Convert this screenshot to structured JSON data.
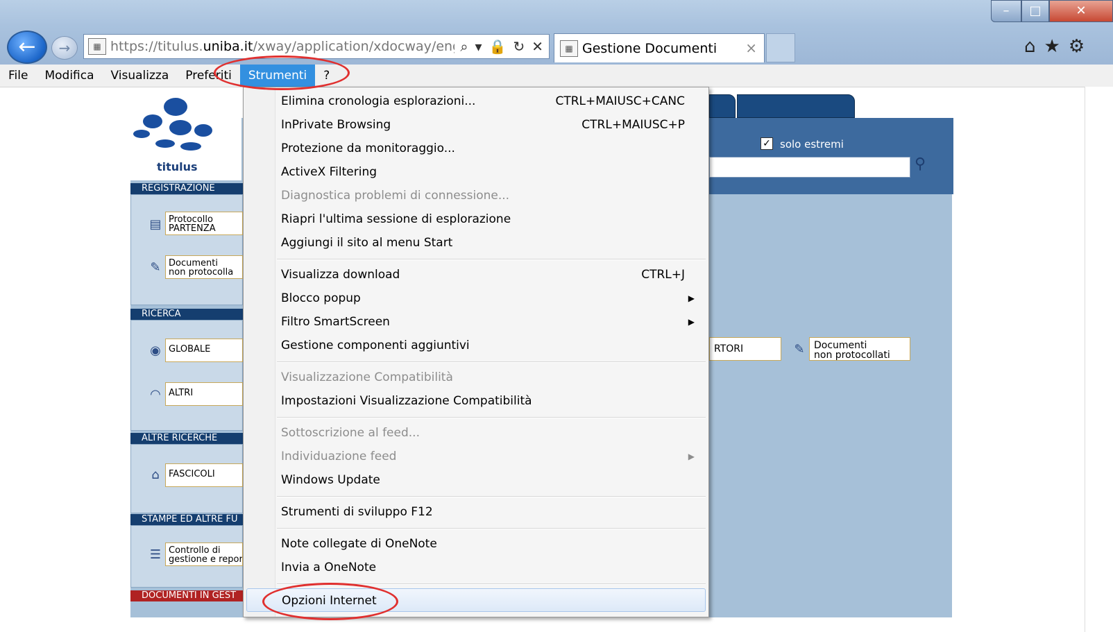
{
  "browser": {
    "address": {
      "url_prefix": "https://titulus.",
      "url_domain": "uniba.it",
      "url_rest": "/xway/application/xdocway/engine/xdc"
    },
    "tab": {
      "title": "Gestione Documenti",
      "close": "×"
    },
    "window_controls": {
      "min": "–",
      "max": "□",
      "close": "✕"
    },
    "icons": {
      "back": "←",
      "forward": "→",
      "search": "⌕",
      "dropdown": "▾",
      "lock": "🔒",
      "refresh": "↻",
      "stop": "✕",
      "home": "⌂",
      "favorites": "★",
      "tools": "⚙"
    }
  },
  "menubar": {
    "items": [
      "File",
      "Modifica",
      "Visualizza",
      "Preferiti",
      "Strumenti",
      "?"
    ]
  },
  "menu": {
    "items": [
      {
        "label": "Elimina cronologia esplorazioni...",
        "shortcut": "CTRL+MAIUSC+CANC"
      },
      {
        "label": "InPrivate Browsing",
        "shortcut": "CTRL+MAIUSC+P"
      },
      {
        "label": "Protezione da monitoraggio..."
      },
      {
        "label": "ActiveX Filtering"
      },
      {
        "label": "Diagnostica problemi di connessione..."
      },
      {
        "label": "Riapri l'ultima sessione di esplorazione"
      },
      {
        "label": "Aggiungi il sito al menu Start"
      },
      {
        "label": "Visualizza download",
        "shortcut": "CTRL+J"
      },
      {
        "label": "Blocco popup",
        "arrow": "▶"
      },
      {
        "label": "Filtro SmartScreen",
        "arrow": "▶"
      },
      {
        "label": "Gestione componenti aggiuntivi"
      },
      {
        "label": "Visualizzazione Compatibilità"
      },
      {
        "label": "Impostazioni Visualizzazione Compatibilità"
      },
      {
        "label": "Sottoscrizione al feed..."
      },
      {
        "label": "Individuazione feed",
        "arrow": "▶"
      },
      {
        "label": "Windows Update"
      },
      {
        "label": "Strumenti di sviluppo F12"
      },
      {
        "label": "Note collegate di OneNote"
      },
      {
        "label": "Invia a OneNote"
      },
      {
        "label": "Opzioni Internet"
      }
    ]
  },
  "page": {
    "logo_text": "titulus",
    "solo_estremi": "solo estremi",
    "check": "✓",
    "sections": {
      "registrazione": "REGISTRAZIONE",
      "ricerca": "RICERCA",
      "altre_ricerche": "ALTRE RICERCHE",
      "stampe": "STAMPE ED ALTRE FU",
      "documenti_gest": "DOCUMENTI IN GEST"
    },
    "buttons": {
      "protocollo_1": "Protocollo",
      "protocollo_2": "PARTENZA",
      "documenti_1": "Documenti",
      "documenti_2": "non protocolla",
      "globale": "GLOBALE",
      "altri": "ALTRI",
      "fascicoli": "FASCICOLI",
      "controllo_1": "Controllo di",
      "controllo_2": "gestione e reportis",
      "repertori": "RTORI",
      "doc_np_1": "Documenti",
      "doc_np_2": "non protocollati"
    }
  }
}
